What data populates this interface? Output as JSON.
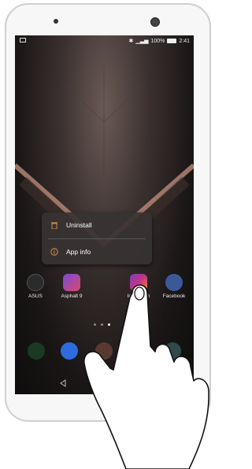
{
  "statusbar": {
    "battery": "100%",
    "time": "2:41"
  },
  "context_menu": {
    "uninstall_label": "Uninstall",
    "app_info_label": "App info"
  },
  "apps": [
    {
      "label": "ASUS",
      "icon": "asus-folder-icon"
    },
    {
      "label": "Asphalt 9",
      "icon": "asphalt-icon"
    },
    {
      "label": "Instagram",
      "icon": "instagram-icon"
    },
    {
      "label": "Facebook",
      "icon": "facebook-icon"
    }
  ],
  "dock": [
    {
      "icon": "phone-icon"
    },
    {
      "icon": "messages-icon"
    },
    {
      "icon": "browser-icon"
    },
    {
      "icon": "camera-icon"
    },
    {
      "icon": "gallery-icon"
    }
  ],
  "colors": {
    "instagram": "#c13584",
    "facebook": "#3b5998",
    "phone": "#1b8a3a",
    "messages": "#2d6cdf"
  }
}
